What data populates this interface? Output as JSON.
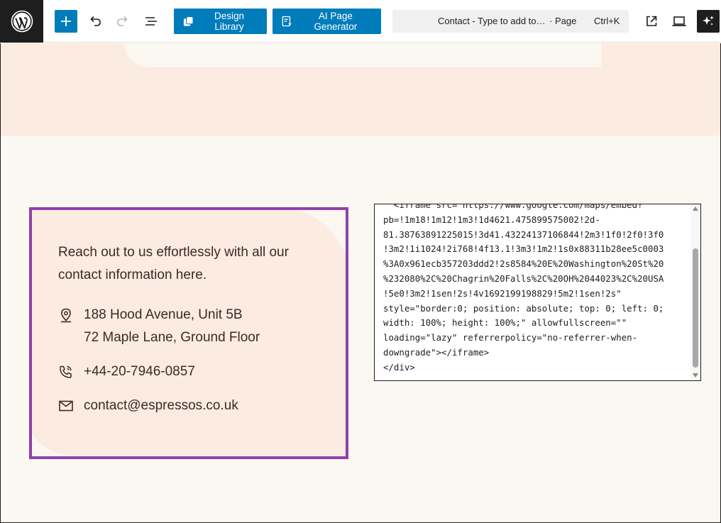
{
  "toolbar": {
    "design_library_label": "Design Library",
    "ai_generator_label": "AI Page Generator",
    "command_bar": {
      "title": "Contact - Type to add to…",
      "type": "· Page",
      "shortcut": "Ctrl+K"
    }
  },
  "contact_card": {
    "intro": "Reach out to us effortlessly with all our contact information here.",
    "address_line1": "188 Hood Avenue, Unit 5B",
    "address_line2": "72 Maple Lane, Ground Floor",
    "phone": "+44-20-7946-0857",
    "email": "contact@espressos.co.uk"
  },
  "code_box": {
    "lines": [
      "  <iframe src=\"https://www.google.com/maps/embed?",
      "pb=!1m18!1m12!1m3!1d4621.475899575002!2d-",
      "81.38763891225015!3d41.43224137106844!2m3!1f0!2f0!3f0",
      "!3m2!1i1024!2i768!4f13.1!3m3!1m2!1s0x88311b28ee5c0003",
      "%3A0x961ecb357203ddd2!2s8584%20E%20Washington%20St%20",
      "%232080%2C%20Chagrin%20Falls%2C%20OH%2044023%2C%20USA",
      "!5e0!3m2!1sen!2s!4v1692199198829!5m2!1sen!2s\"",
      "style=\"border:0; position: absolute; top: 0; left: 0;",
      "width: 100%; height: 100%;\" allowfullscreen=\"\"",
      "loading=\"lazy\" referrerpolicy=\"no-referrer-when-",
      "downgrade\"></iframe>",
      "</div>"
    ]
  },
  "colors": {
    "accent_blue": "#007cba",
    "card_border": "#9141ac",
    "peach": "#fcebe1",
    "cream": "#faf8f0",
    "text_brown": "#3b2a26"
  },
  "icons": {
    "logo": "wordpress-logo",
    "add": "plus-icon",
    "undo": "undo-icon",
    "redo": "redo-icon",
    "outline": "list-view-icon",
    "design": "design-library-icon",
    "ai": "ai-page-icon",
    "view": "external-link-icon",
    "preview": "laptop-icon",
    "sparkle": "sparkle-icon",
    "address": "map-pin-icon",
    "phone": "phone-icon",
    "email": "mail-icon"
  }
}
